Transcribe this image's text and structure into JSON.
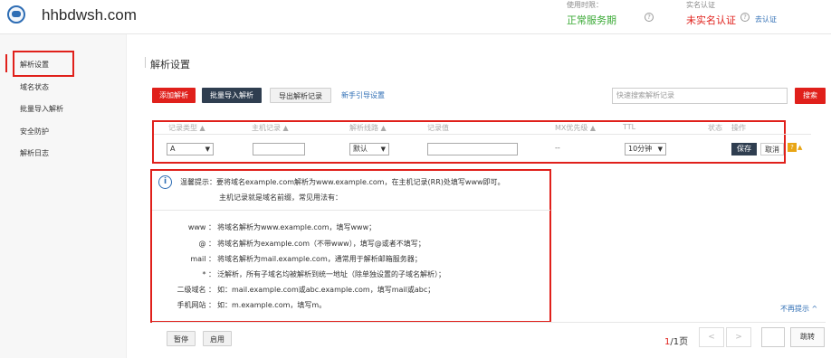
{
  "header": {
    "domain": "hhbdwsh.com",
    "usage_label": "使用时限：",
    "usage_value": "正常服务期",
    "realname_label": "实名认证",
    "realname_value": "未实名认证",
    "verify_link": "去认证",
    "help_glyph": "?"
  },
  "sidebar": {
    "items": [
      {
        "label": "解析设置",
        "active": true
      },
      {
        "label": "域名状态"
      },
      {
        "label": "批量导入解析"
      },
      {
        "label": "安全防护"
      },
      {
        "label": "解析日志"
      }
    ]
  },
  "main": {
    "title": "解析设置",
    "toolbar": {
      "add_label": "添加解析",
      "batch_label": "批量导入解析",
      "export_label": "导出解析记录",
      "guide_label": "新手引导设置",
      "search_placeholder": "快速搜索解析记录",
      "search_label": "搜索"
    },
    "columns": {
      "type": "记录类型 ▲",
      "host": "主机记录 ▲",
      "line": "解析线路 ▲",
      "value": "记录值",
      "mx": "MX优先级 ▲",
      "ttl": "TTL",
      "status": "状态",
      "ops": "操作"
    },
    "edit_row": {
      "type": "A",
      "line": "默认",
      "mx": "--",
      "ttl": "10分钟",
      "save": "保存",
      "cancel": "取消",
      "arrow": "▼",
      "help": "?",
      "help_caret": "▲"
    },
    "tip": {
      "info_glyph": "i",
      "line1": "温馨提示：要将域名example.com解析为www.example.com，在主机记录(RR)处填写www即可。",
      "line2": "主机记录就是域名前缀，常见用法有：",
      "records": [
        {
          "key": "www ：",
          "desc": "将域名解析为www.example.com，填写www；"
        },
        {
          "key": "@ ：",
          "desc": "将域名解析为example.com（不带www），填写@或者不填写；"
        },
        {
          "key": "mail ：",
          "desc": "将域名解析为mail.example.com，通常用于解析邮箱服务器；"
        },
        {
          "key": "* ：",
          "desc": "泛解析，所有子域名均被解析到统一地址（除单独设置的子域名解析）；"
        },
        {
          "key": "二级域名 ：",
          "desc": "如：mail.example.com或abc.example.com，填写mail或abc；"
        },
        {
          "key": "手机网站 ：",
          "desc": "如：m.example.com，填写m。"
        }
      ],
      "hide_label": "不再提示 ^"
    },
    "footer": {
      "pause_label": "暂停",
      "enable_label": "启用",
      "page_current": "1",
      "page_total": "/1页",
      "prev_glyph": "<",
      "next_glyph": ">",
      "jump_label": "跳转"
    }
  },
  "colors": {
    "accent_red": "#e0201b",
    "link_blue": "#2e6db4",
    "ok_green": "#3aa935",
    "dark_button": "#2f3e50"
  }
}
